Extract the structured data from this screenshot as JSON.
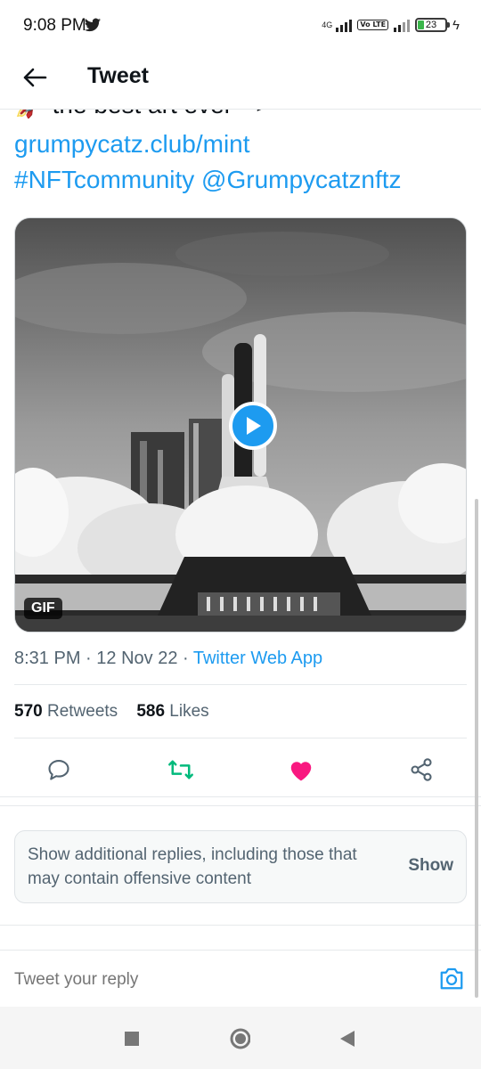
{
  "status_bar": {
    "time": "9:08 PM",
    "network_label": "4G",
    "volte_label": "Vo LTE",
    "battery": "23",
    "icons": [
      "twitter-icon",
      "signal-icon",
      "battery-icon",
      "charging-icon"
    ]
  },
  "header": {
    "title": "Tweet",
    "back_icon": "arrow-left-icon"
  },
  "tweet": {
    "clipped_line": "🚀 the best art ever -->",
    "link_line_1": "grumpycatz.club/mint",
    "link_line_2": "#NFTcommunity @Grumpycatznftz",
    "media": {
      "badge": "GIF",
      "play_icon": "play-icon"
    },
    "time": "8:31 PM",
    "date": "12 Nov 22",
    "source": "Twitter Web App",
    "retweets_count": "570",
    "retweets_label": "Retweets",
    "likes_count": "586",
    "likes_label": "Likes",
    "actions": [
      "reply-icon",
      "retweet-icon",
      "like-icon",
      "share-icon"
    ]
  },
  "replies_notice": {
    "text": "Show additional replies, including those that may contain offensive content",
    "button": "Show"
  },
  "reply_bar": {
    "placeholder": "Tweet your reply",
    "camera_icon": "camera-icon"
  },
  "colors": {
    "accent": "#1d9bf0",
    "retweet": "#00ba7c",
    "like": "#f91880",
    "muted": "#536471"
  }
}
